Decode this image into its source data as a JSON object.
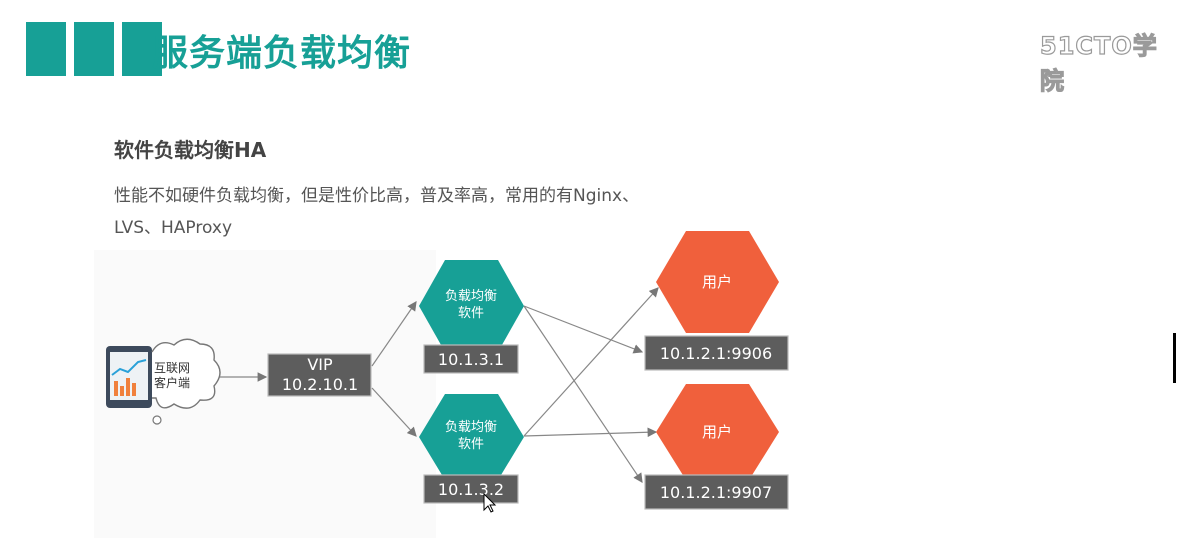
{
  "header": {
    "title": "服务端负载均衡",
    "logo": "51CTO学院"
  },
  "section": {
    "subtitle": "软件负载均衡HA",
    "desc_line1": "性能不如硬件负载均衡，但是性价比高，普及率高，常用的有Nginx、",
    "desc_line2": "LVS、HAProxy"
  },
  "diagram": {
    "client": {
      "line1": "互联网",
      "line2": "客户端"
    },
    "vip": {
      "line1": "VIP",
      "line2": "10.2.10.1"
    },
    "lb1": {
      "line1": "负载均衡",
      "line2": "软件",
      "ip": "10.1.3.1"
    },
    "lb2": {
      "line1": "负载均衡",
      "line2": "软件",
      "ip": "10.1.3.2"
    },
    "user1": {
      "label": "用户",
      "ip": "10.1.2.1:9906"
    },
    "user2": {
      "label": "用户",
      "ip": "10.1.2.1:9907"
    },
    "colors": {
      "teal": "#17a096",
      "orange": "#f0603c",
      "box": "#606060"
    }
  }
}
